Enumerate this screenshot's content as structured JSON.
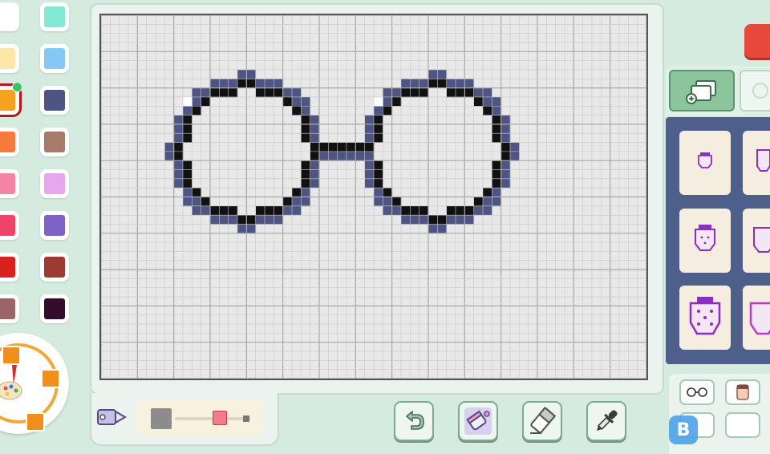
{
  "palette": {
    "colors": [
      "#ffffff",
      "#82ead4",
      "#fde6a8",
      "#85c8f5",
      "#f5a221",
      "#4e5583",
      "#f57a3c",
      "#a57c6b",
      "#f484a3",
      "#e8a6ee",
      "#ef4467",
      "#7e62c5",
      "#d9211d",
      "#9c3b34",
      "#9b6567",
      "#330d2b"
    ],
    "selected_index": 4
  },
  "canvas": {
    "cols": 30,
    "rows": 20,
    "background": "#e8e8e8",
    "outline_color": "#111111",
    "shade_color": "#4e5583",
    "highlight_color": "#ffffff"
  },
  "slider": {
    "left_color": "#8c8c8c",
    "thumb_color": "#f47a8a",
    "value_fraction": 0.6
  },
  "tools": [
    {
      "name": "undo-button",
      "icon": "undo-icon"
    },
    {
      "name": "fill-bucket-button",
      "icon": "paint-bucket-icon"
    },
    {
      "name": "eraser-button",
      "icon": "eraser-icon"
    },
    {
      "name": "eyedropper-button",
      "icon": "eyedropper-icon"
    }
  ],
  "right_panel": {
    "tab_active": "add-pattern-icon",
    "tiles": [
      "strawberry-small-icon",
      "strawberry-medium-icon",
      "strawberry-large-icon"
    ],
    "bottom_buttons": [
      "glasses-icon",
      "face-icon"
    ]
  },
  "watermark": {
    "text": "B"
  }
}
